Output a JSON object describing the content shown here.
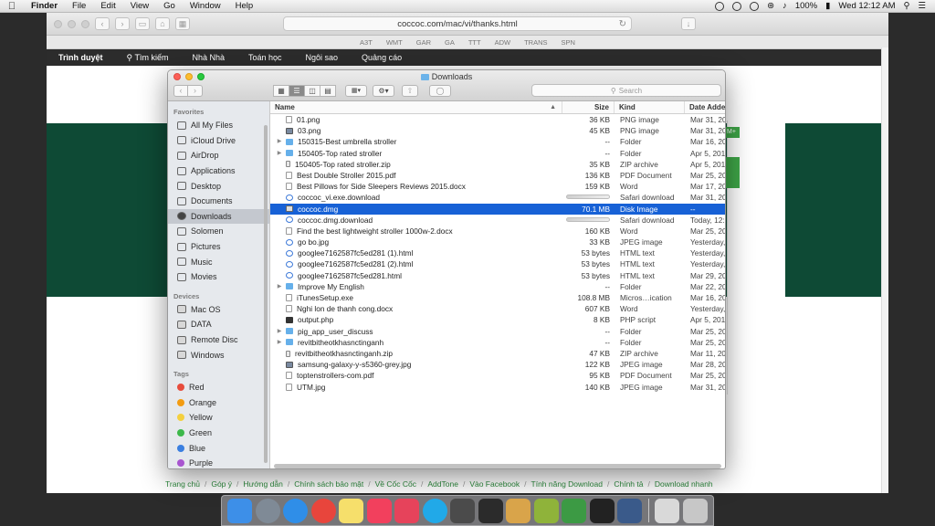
{
  "menubar": {
    "app": "Finder",
    "items": [
      "File",
      "Edit",
      "View",
      "Go",
      "Window",
      "Help"
    ],
    "battery": "100%",
    "clock": "Wed 12:12 AM"
  },
  "browser": {
    "url": "coccoc.com/mac/vi/thanks.html",
    "bookmarks": [
      "A3T",
      "WMT",
      "GAR",
      "GA",
      "TTT",
      "ADW",
      "TRANS",
      "SPN"
    ],
    "nav": [
      "Trình duyệt",
      "Tìm kiếm",
      "Nhà Nhà",
      "Toán học",
      "Ngôi sao",
      "Quảng cáo"
    ],
    "green_button_label": "M+",
    "footer_links": [
      "Trang chủ",
      "Góp ý",
      "Hướng dẫn",
      "Chính sách bảo mật",
      "Về Cốc Cốc",
      "AddTone",
      "Vào Facebook",
      "Tính năng Download",
      "Chính tả",
      "Download nhanh"
    ]
  },
  "finder": {
    "title": "Downloads",
    "search_placeholder": "Search",
    "columns": {
      "name": "Name",
      "size": "Size",
      "kind": "Kind",
      "date": "Date Added"
    },
    "sidebar": {
      "favorites_label": "Favorites",
      "favorites": [
        "All My Files",
        "iCloud Drive",
        "AirDrop",
        "Applications",
        "Desktop",
        "Documents",
        "Downloads",
        "Solomen",
        "Pictures",
        "Music",
        "Movies"
      ],
      "devices_label": "Devices",
      "devices": [
        "Mac OS",
        "DATA",
        "Remote Disc",
        "Windows"
      ],
      "tags_label": "Tags",
      "tags": [
        {
          "name": "Red",
          "color": "#e74c3c"
        },
        {
          "name": "Orange",
          "color": "#f39c12"
        },
        {
          "name": "Yellow",
          "color": "#f4d03f"
        },
        {
          "name": "Green",
          "color": "#3cb84a"
        },
        {
          "name": "Blue",
          "color": "#3a7fe0"
        },
        {
          "name": "Purple",
          "color": "#a855d0"
        }
      ]
    },
    "files": [
      {
        "name": "01.png",
        "size": "36 KB",
        "kind": "PNG image",
        "date": "Mar 31, 20",
        "icon": "file"
      },
      {
        "name": "03.png",
        "size": "45 KB",
        "kind": "PNG image",
        "date": "Mar 31, 20",
        "icon": "img"
      },
      {
        "name": "150315-Best umbrella stroller",
        "size": "--",
        "kind": "Folder",
        "date": "Mar 16, 20",
        "icon": "folder"
      },
      {
        "name": "150405-Top rated stroller",
        "size": "--",
        "kind": "Folder",
        "date": "Apr 5, 201",
        "icon": "folder"
      },
      {
        "name": "150405-Top rated stroller.zip",
        "size": "35 KB",
        "kind": "ZIP archive",
        "date": "Apr 5, 201",
        "icon": "zip"
      },
      {
        "name": "Best Double Stroller 2015.pdf",
        "size": "136 KB",
        "kind": "PDF Document",
        "date": "Mar 25, 20",
        "icon": "file"
      },
      {
        "name": "Best Pillows for Side Sleepers Reviews 2015.docx",
        "size": "159 KB",
        "kind": "Word",
        "date": "Mar 17, 20",
        "icon": "file"
      },
      {
        "name": "coccoc_vi.exe.download",
        "size": "",
        "kind": "Safari download",
        "date": "Mar 31, 20",
        "icon": "safari"
      },
      {
        "name": "coccoc.dmg",
        "size": "70.1 MB",
        "kind": "Disk Image",
        "date": "--",
        "icon": "dmg"
      },
      {
        "name": "coccoc.dmg.download",
        "size": "",
        "kind": "Safari download",
        "date": "Today, 12:",
        "icon": "safari"
      },
      {
        "name": "Find the best lightweight stroller 1000w-2.docx",
        "size": "160 KB",
        "kind": "Word",
        "date": "Mar 25, 20",
        "icon": "file"
      },
      {
        "name": "go bo.jpg",
        "size": "33 KB",
        "kind": "JPEG image",
        "date": "Yesterday,",
        "icon": "safari"
      },
      {
        "name": "googlee7162587fc5ed281 (1).html",
        "size": "53 bytes",
        "kind": "HTML text",
        "date": "Yesterday,",
        "icon": "safari"
      },
      {
        "name": "googlee7162587fc5ed281 (2).html",
        "size": "53 bytes",
        "kind": "HTML text",
        "date": "Yesterday,",
        "icon": "safari"
      },
      {
        "name": "googlee7162587fc5ed281.html",
        "size": "53 bytes",
        "kind": "HTML text",
        "date": "Mar 29, 20",
        "icon": "safari"
      },
      {
        "name": "Improve My English",
        "size": "--",
        "kind": "Folder",
        "date": "Mar 22, 20",
        "icon": "folder"
      },
      {
        "name": "iTunesSetup.exe",
        "size": "108.8 MB",
        "kind": "Micros…ication",
        "date": "Mar 16, 20",
        "icon": "file"
      },
      {
        "name": "Nghi lon de thanh cong.docx",
        "size": "607 KB",
        "kind": "Word",
        "date": "Yesterday,",
        "icon": "file"
      },
      {
        "name": "output.php",
        "size": "8 KB",
        "kind": "PHP script",
        "date": "Apr 5, 201",
        "icon": "php"
      },
      {
        "name": "pig_app_user_discuss",
        "size": "--",
        "kind": "Folder",
        "date": "Mar 25, 20",
        "icon": "folder"
      },
      {
        "name": "revitbitheotkhasnctinganh",
        "size": "--",
        "kind": "Folder",
        "date": "Mar 25, 20",
        "icon": "folder"
      },
      {
        "name": "revitbitheotkhasnctinganh.zip",
        "size": "47 KB",
        "kind": "ZIP archive",
        "date": "Mar 11, 20",
        "icon": "zip"
      },
      {
        "name": "samsung-galaxy-y-s5360-grey.jpg",
        "size": "122 KB",
        "kind": "JPEG image",
        "date": "Mar 28, 20",
        "icon": "img"
      },
      {
        "name": "toptenstrollers-com.pdf",
        "size": "95 KB",
        "kind": "PDF Document",
        "date": "Mar 25, 20",
        "icon": "file"
      },
      {
        "name": "UTM.jpg",
        "size": "140 KB",
        "kind": "JPEG image",
        "date": "Mar 31, 20",
        "icon": "file"
      }
    ]
  },
  "dock": {
    "apps": [
      {
        "name": "finder-icon",
        "color": "#3d8fe8"
      },
      {
        "name": "launchpad-icon",
        "color": "#7f8a96"
      },
      {
        "name": "safari-icon",
        "color": "#2f8ee8"
      },
      {
        "name": "chrome-icon",
        "color": "#e8453c"
      },
      {
        "name": "notes-icon",
        "color": "#f6df6b"
      },
      {
        "name": "itunes-icon",
        "color": "#f2405d"
      },
      {
        "name": "lips-icon",
        "color": "#e6435b"
      },
      {
        "name": "skype-icon",
        "color": "#21a9e8"
      },
      {
        "name": "sublime-icon",
        "color": "#4b4b4b"
      },
      {
        "name": "plugin-icon",
        "color": "#2b2b2b"
      },
      {
        "name": "lotus-icon",
        "color": "#d9a44a"
      },
      {
        "name": "coccoc-icon",
        "color": "#8fb33a"
      },
      {
        "name": "evernote-icon",
        "color": "#3c9a44"
      },
      {
        "name": "terminal-icon",
        "color": "#222222"
      },
      {
        "name": "quicktime-icon",
        "color": "#3a5a8a"
      },
      {
        "name": "document-icon",
        "color": "#d9d9d9"
      },
      {
        "name": "trash-icon",
        "color": "#c7c7c7"
      }
    ]
  }
}
